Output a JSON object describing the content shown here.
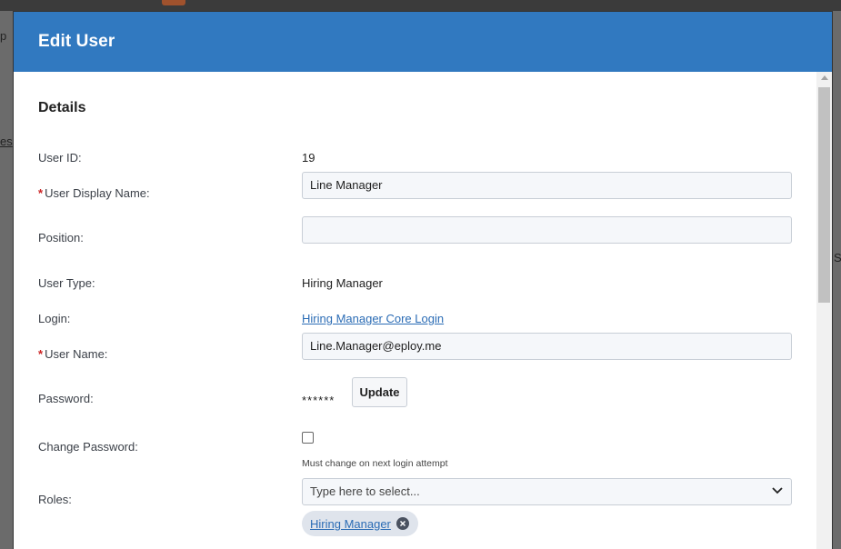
{
  "modal": {
    "title": "Edit User"
  },
  "details": {
    "section_title": "Details",
    "user_id": {
      "label": "User ID:",
      "value": "19"
    },
    "display_name": {
      "label": "User Display Name:",
      "value": "Line Manager"
    },
    "position": {
      "label": "Position:",
      "value": ""
    },
    "user_type": {
      "label": "User Type:",
      "value": "Hiring Manager"
    },
    "login": {
      "label": "Login:",
      "link": "Hiring Manager Core Login"
    },
    "user_name": {
      "label": "User Name:",
      "value": "Line.Manager@eploy.me"
    },
    "password": {
      "label": "Password:",
      "mask": "******",
      "button": "Update"
    },
    "change_password": {
      "label": "Change Password:",
      "checked": false,
      "hint": "Must change on next login attempt"
    },
    "roles": {
      "label": "Roles:",
      "placeholder": "Type here to select...",
      "selected": [
        "Hiring Manager"
      ]
    }
  },
  "backdrop": {
    "frag_left_1": "p",
    "frag_left_2": "es",
    "frag_right_1": "S"
  },
  "colors": {
    "header": "#3179c0",
    "link": "#2b6cb5",
    "required": "#cc2222"
  }
}
